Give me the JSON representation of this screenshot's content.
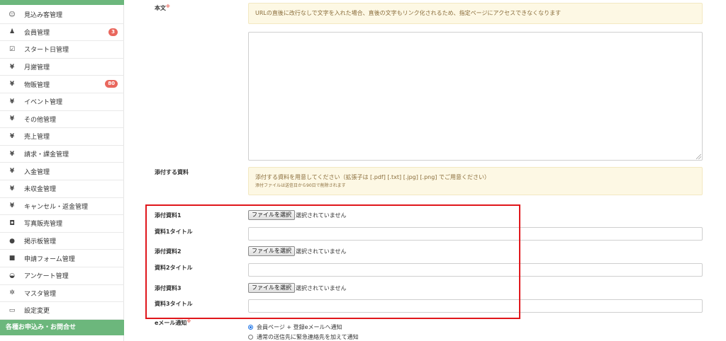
{
  "sidebar": {
    "items": [
      {
        "icon": "☺",
        "icon_name": "smile-icon",
        "label": "見込み客管理",
        "badge": ""
      },
      {
        "icon": "♟",
        "icon_name": "user-icon",
        "label": "会員管理",
        "badge": "3"
      },
      {
        "icon": "☑",
        "icon_name": "check-square-icon",
        "label": "スタート日管理",
        "badge": ""
      },
      {
        "icon": "¥",
        "icon_name": "yen-icon",
        "label": "月謝管理",
        "badge": ""
      },
      {
        "icon": "¥",
        "icon_name": "yen-icon",
        "label": "物販管理",
        "badge": "80"
      },
      {
        "icon": "¥",
        "icon_name": "yen-icon",
        "label": "イベント管理",
        "badge": ""
      },
      {
        "icon": "¥",
        "icon_name": "yen-icon",
        "label": "その他管理",
        "badge": ""
      },
      {
        "icon": "¥",
        "icon_name": "yen-icon",
        "label": "売上管理",
        "badge": ""
      },
      {
        "icon": "¥",
        "icon_name": "yen-icon",
        "label": "請求・課金管理",
        "badge": ""
      },
      {
        "icon": "¥",
        "icon_name": "yen-icon",
        "label": "入金管理",
        "badge": ""
      },
      {
        "icon": "¥",
        "icon_name": "yen-icon",
        "label": "未収金管理",
        "badge": ""
      },
      {
        "icon": "¥",
        "icon_name": "yen-icon",
        "label": "キャンセル・返金管理",
        "badge": ""
      },
      {
        "icon": "◘",
        "icon_name": "camera-icon",
        "label": "写真販売管理",
        "badge": ""
      },
      {
        "icon": "●",
        "icon_name": "comment-icon",
        "label": "掲示板管理",
        "badge": ""
      },
      {
        "icon": "■",
        "icon_name": "file-icon",
        "label": "申請フォーム管理",
        "badge": ""
      },
      {
        "icon": "◒",
        "icon_name": "dashboard-icon",
        "label": "アンケート管理",
        "badge": ""
      },
      {
        "icon": "✲",
        "icon_name": "gear-icon",
        "label": "マスタ管理",
        "badge": ""
      },
      {
        "icon": "▭",
        "icon_name": "monitor-icon",
        "label": "設定変更",
        "badge": ""
      }
    ],
    "section_label": "各種お申込み・お問合せ"
  },
  "form": {
    "body_label": "本文",
    "required_mark": "※",
    "body_notice": "URLの直後に改行なしで文字を入れた場合、直後の文字もリンク化されるため、指定ページにアクセスできなくなります",
    "attach_label": "添付する資料",
    "attach_notice": "添付する資料を用意してください（拡張子は [.pdf] [.txt] [.jpg] [.png] でご用意ください）",
    "attach_note": "添付ファイルは送信日から90日で削除されます",
    "file_button": "ファイルを選択",
    "file_status": "選択されていません",
    "attachments": [
      {
        "file_label": "添付資料1",
        "title_label": "資料1タイトル"
      },
      {
        "file_label": "添付資料2",
        "title_label": "資料2タイトル"
      },
      {
        "file_label": "添付資料3",
        "title_label": "資料3タイトル"
      }
    ],
    "email_label": "eメール通知",
    "email_options": [
      {
        "label": "会員ページ + 登録eメールへ通知",
        "selected": true
      },
      {
        "label": "通常の送信先に緊急連絡先を加えて通知",
        "selected": false
      }
    ]
  },
  "colors": {
    "sidebar_green": "#6cb77c",
    "badge_red": "#e9675d",
    "highlight_red": "#e0161b",
    "notice_bg": "#fdf8e4"
  }
}
